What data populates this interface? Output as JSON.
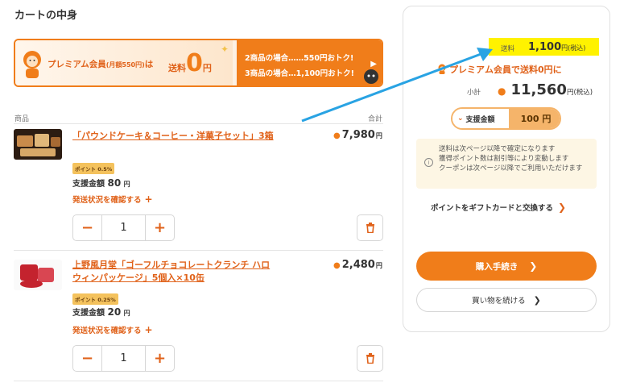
{
  "page": {
    "title": "カートの中身"
  },
  "banner": {
    "premium_text": "プレミアム会員",
    "premium_fee": "(月額550円)",
    "premium_ha": "は",
    "free_label": "送料",
    "free_zero": "0",
    "free_yen": "円",
    "row1": "2商品の場合……550円おトク!",
    "row2": "3商品の場合…1,100円おトク!"
  },
  "table": {
    "col_product": "商品",
    "col_total": "合計"
  },
  "products": [
    {
      "name": "「パウンドケーキ＆コーヒー・洋菓子セット」3箱",
      "price": "7,980",
      "price_unit": "円",
      "point_badge": "ポイント 0.5%",
      "pay_label": "支援金額",
      "pay_amount": "80",
      "pay_unit": "円",
      "ship_status": "発送状況を確認する",
      "quantity": "1"
    },
    {
      "name": "上野風月堂「ゴーフルチョコレートクランチ ハロウィンパッケージ」5個入×10缶",
      "price": "2,480",
      "price_unit": "円",
      "point_badge": "ポイント 0.25%",
      "pay_label": "支援金額",
      "pay_amount": "20",
      "pay_unit": "円",
      "ship_status": "発送状況を確認する",
      "quantity": "1"
    }
  ],
  "summary": {
    "shipping_label": "送料",
    "shipping_value": "1,100",
    "shipping_unit": "円(税込)",
    "premium_free": "プレミアム会員で送料0円に",
    "subtotal_label": "小計",
    "subtotal_value": "11,560",
    "subtotal_unit": "円(税込)",
    "pay_label": "支援金額",
    "pay_value": "100 円",
    "notice": [
      "送料は次ページ以降で確定になります",
      "獲得ポイント数は割引等により変動します",
      "クーポンは次ページ以降でご利用いただけます"
    ],
    "gift_card": "ポイントをギフトカードと交換する",
    "checkout": "購入手続き",
    "continue": "買い物を続ける"
  },
  "colors": {
    "accent": "#f07d1a",
    "highlight": "#fff200",
    "arrow": "#29a3e3"
  }
}
